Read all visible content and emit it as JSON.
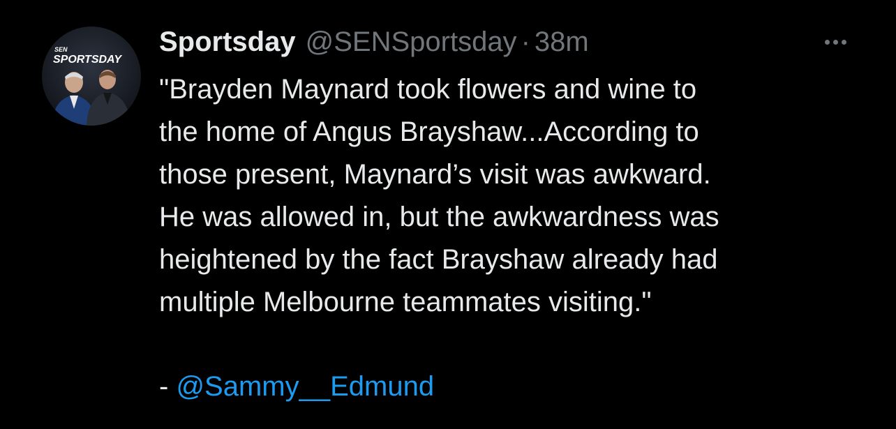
{
  "tweet": {
    "author": {
      "display_name": "Sportsday",
      "handle": "@SENSportsday",
      "separator": "·",
      "time": "38m",
      "avatar": {
        "brand_small": "SEN",
        "brand_large": "SPORTSDAY"
      }
    },
    "body_lines": [
      "\"Brayden Maynard took flowers and wine to",
      "the home of Angus Brayshaw...According to",
      "those present, Maynard’s visit was awkward.",
      "He was allowed in, but the awkwardness was",
      "heightened by the fact Brayshaw already had",
      "multiple Melbourne teammates visiting.\""
    ],
    "signoff_prefix": "- ",
    "mention": "@Sammy__Edmund",
    "more_icon": "ellipsis-icon"
  },
  "colors": {
    "background": "#000000",
    "text": "#e7e9ea",
    "secondary": "#71767b",
    "link": "#1d9bf0"
  }
}
